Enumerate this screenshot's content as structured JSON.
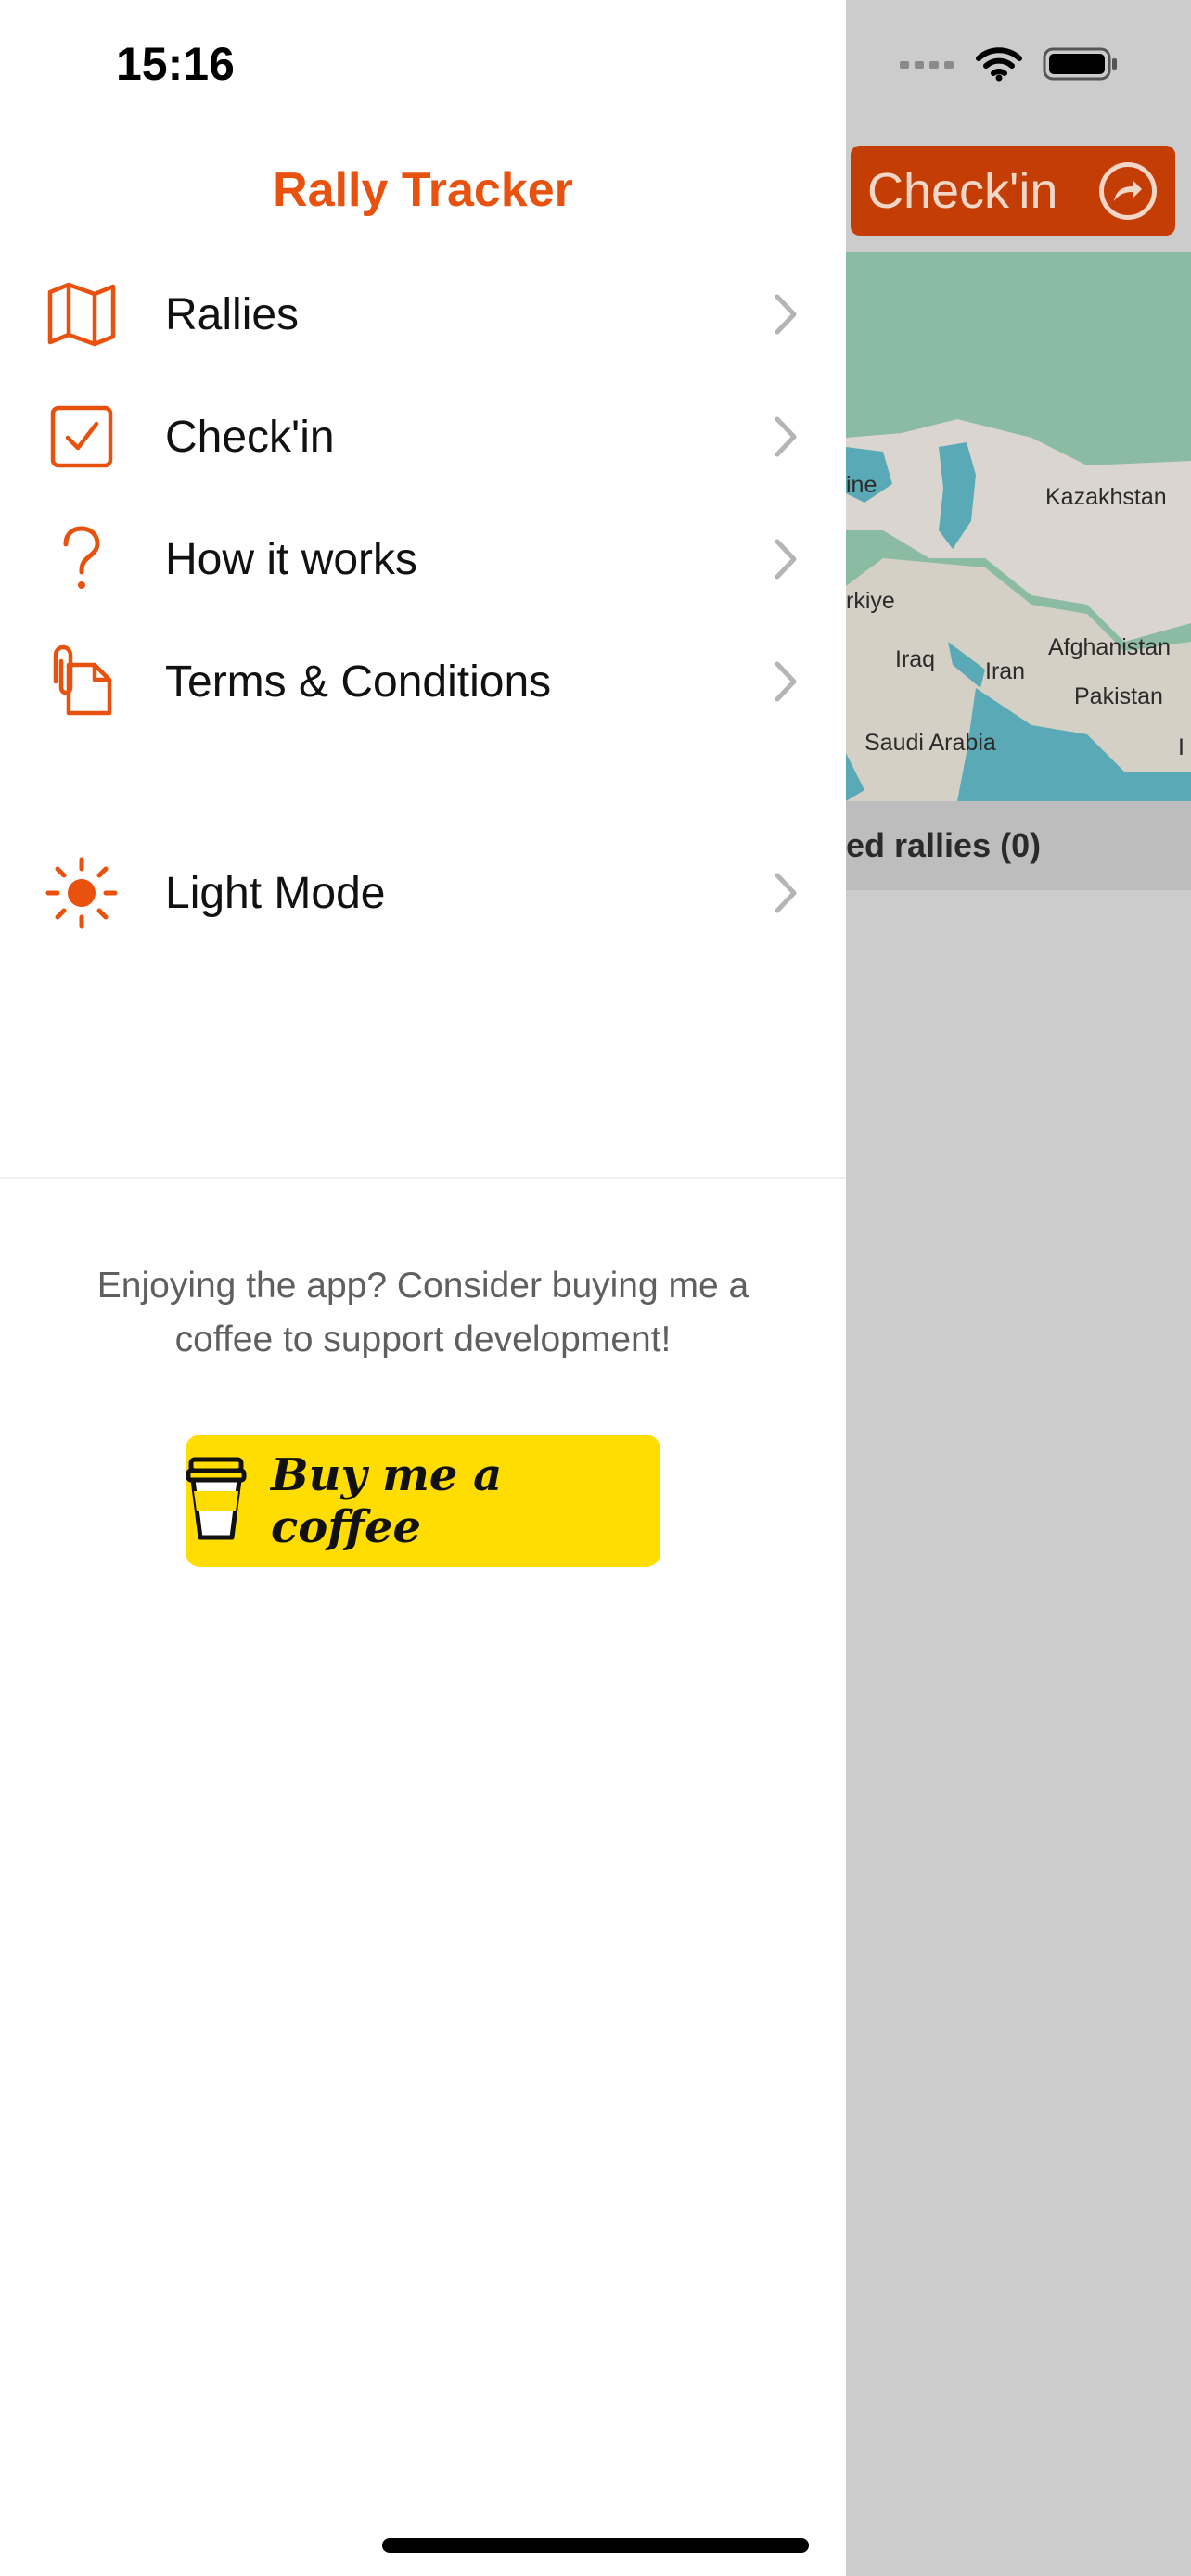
{
  "status_bar": {
    "time": "15:16"
  },
  "background": {
    "checkin_button_label": "Check'in",
    "map_labels": [
      "ine",
      "Kazakhstan",
      "rkiye",
      "Iraq",
      "Iran",
      "Afghanistan",
      "Pakistan",
      "Saudi Arabia",
      "I"
    ],
    "rallies_bar_label": "ed rallies (0)"
  },
  "drawer": {
    "title": "Rally Tracker",
    "menu_items": [
      {
        "label": "Rallies",
        "icon": "map-icon"
      },
      {
        "label": "Check'in",
        "icon": "checkbox-icon"
      },
      {
        "label": "How it works",
        "icon": "question-icon"
      },
      {
        "label": "Terms & Conditions",
        "icon": "document-clip-icon"
      }
    ],
    "mode_item": {
      "label": "Light Mode",
      "icon": "sun-icon"
    },
    "promo_text": "Enjoying the app? Consider buying me a coffee to support development!",
    "coffee_button_label": "Buy me a coffee"
  },
  "colors": {
    "accent": "#e8520e",
    "checkin_bg": "#c43d05",
    "coffee_bg": "#ffdd00",
    "overlay": "#cccccc"
  }
}
